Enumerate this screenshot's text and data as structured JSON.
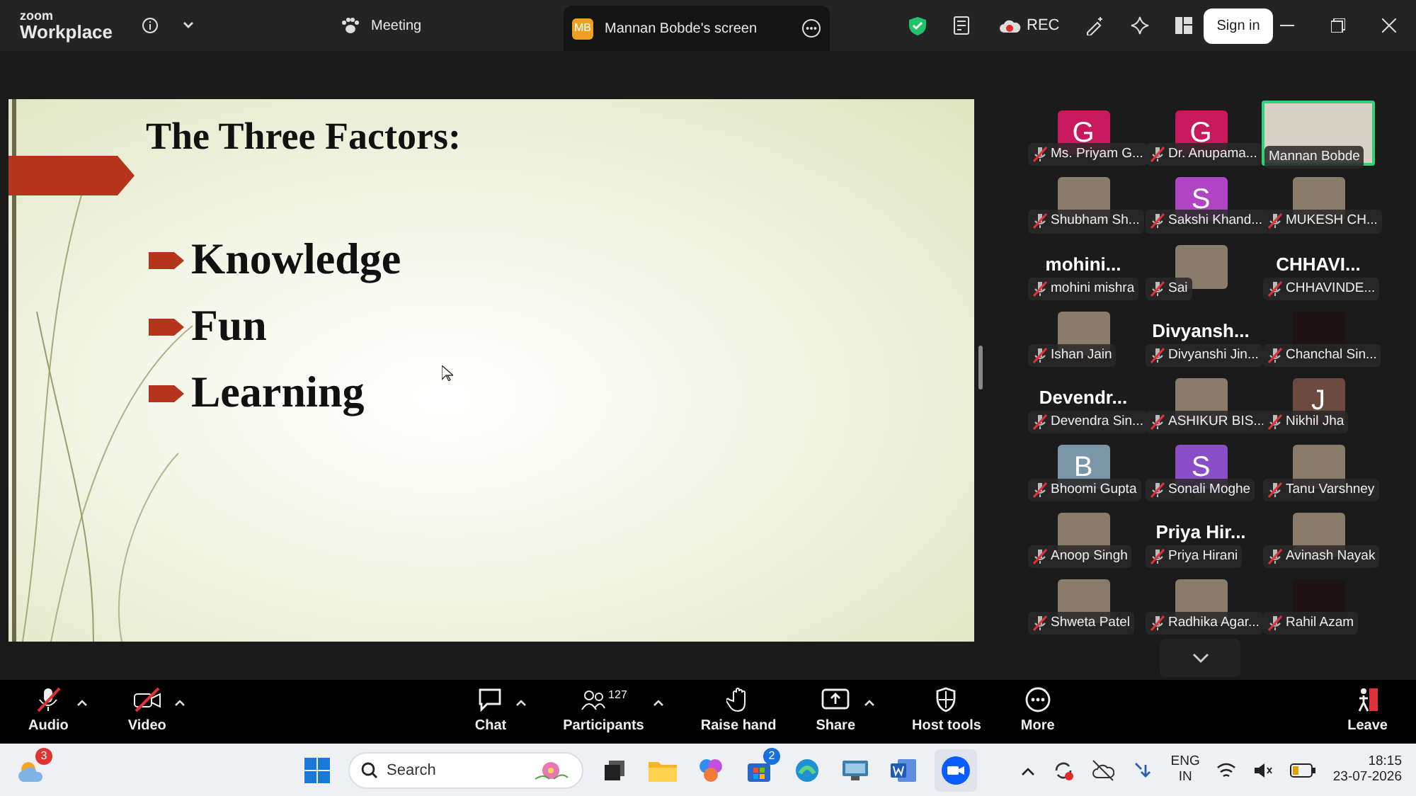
{
  "app_bar": {
    "logo_top": "zoom",
    "logo_bottom": "Workplace",
    "meeting_label": "Meeting",
    "share_tab": {
      "initials": "MB",
      "title": "Mannan Bobde's screen"
    },
    "rec_label": "REC",
    "sign_in": "Sign in"
  },
  "slide": {
    "title": "The Three Factors:",
    "bullets": [
      "Knowledge",
      "Fun",
      "Learning"
    ]
  },
  "participants": [
    {
      "kind": "letter",
      "letter": "G",
      "color": "#c8185e",
      "name": "Ms. Priyam G...",
      "muted": true,
      "speaking": false
    },
    {
      "kind": "letter",
      "letter": "G",
      "color": "#c8185e",
      "name": "Dr. Anupama...",
      "muted": true,
      "speaking": false
    },
    {
      "kind": "video",
      "name": "Mannan Bobde",
      "muted": false,
      "speaking": true
    },
    {
      "kind": "photo",
      "name": "Shubham Sh...",
      "muted": true,
      "speaking": false
    },
    {
      "kind": "letter",
      "letter": "S",
      "color": "#b044c4",
      "name": "Sakshi Khand...",
      "muted": true,
      "speaking": false
    },
    {
      "kind": "photo",
      "name": "MUKESH CH...",
      "muted": true,
      "speaking": false
    },
    {
      "kind": "text",
      "display": "mohini...",
      "name": "mohini mishra",
      "muted": true,
      "speaking": false
    },
    {
      "kind": "photo",
      "name": "Sai",
      "muted": true,
      "speaking": false
    },
    {
      "kind": "text",
      "display": "CHHAVI...",
      "name": "CHHAVINDE...",
      "muted": true,
      "speaking": false
    },
    {
      "kind": "photo",
      "name": "Ishan Jain",
      "muted": true,
      "speaking": false
    },
    {
      "kind": "text",
      "display": "Divyansh...",
      "name": "Divyanshi Jin...",
      "muted": true,
      "speaking": false
    },
    {
      "kind": "blank",
      "name": "Chanchal Sin...",
      "muted": true,
      "speaking": false
    },
    {
      "kind": "text",
      "display": "Devendr...",
      "name": "Devendra Sin...",
      "muted": true,
      "speaking": false
    },
    {
      "kind": "photo",
      "name": "ASHIKUR BIS...",
      "muted": true,
      "speaking": false
    },
    {
      "kind": "letter",
      "letter": "J",
      "color": "#6b4a40",
      "name": "Nikhil Jha",
      "muted": true,
      "speaking": false
    },
    {
      "kind": "letter",
      "letter": "B",
      "color": "#7b96a6",
      "name": "Bhoomi Gupta",
      "muted": true,
      "speaking": false
    },
    {
      "kind": "letter",
      "letter": "S",
      "color": "#8a4fc8",
      "name": "Sonali Moghe",
      "muted": true,
      "speaking": false
    },
    {
      "kind": "photo",
      "name": "Tanu Varshney",
      "muted": true,
      "speaking": false
    },
    {
      "kind": "photo",
      "name": "Anoop Singh",
      "muted": true,
      "speaking": false
    },
    {
      "kind": "text",
      "display": "Priya Hir...",
      "name": "Priya Hirani",
      "muted": true,
      "speaking": false
    },
    {
      "kind": "photo",
      "name": "Avinash Nayak",
      "muted": true,
      "speaking": false
    },
    {
      "kind": "photo",
      "name": "Shweta Patel",
      "muted": true,
      "speaking": false
    },
    {
      "kind": "photo",
      "name": "Radhika Agar...",
      "muted": true,
      "speaking": false
    },
    {
      "kind": "blank",
      "name": "Rahil Azam",
      "muted": true,
      "speaking": false
    }
  ],
  "toolbar": {
    "left": [
      {
        "kind": "audio",
        "label": "Audio",
        "off": true,
        "caret": true
      },
      {
        "kind": "video",
        "label": "Video",
        "off": true,
        "caret": true
      }
    ],
    "center": [
      {
        "kind": "chat",
        "label": "Chat",
        "caret": true
      },
      {
        "kind": "participants",
        "label": "Participants",
        "count": "127",
        "caret": true
      },
      {
        "kind": "raise-hand",
        "label": "Raise hand",
        "caret": false
      },
      {
        "kind": "share",
        "label": "Share",
        "caret": true
      },
      {
        "kind": "host-tools",
        "label": "Host tools",
        "caret": false
      },
      {
        "kind": "more",
        "label": "More",
        "caret": false
      }
    ],
    "right": [
      {
        "kind": "leave",
        "label": "Leave",
        "caret": false
      }
    ]
  },
  "taskbar": {
    "weather_badge": "3",
    "search_placeholder": "Search",
    "store_badge": "2",
    "language": "ENG",
    "region": "IN",
    "time": "18:15",
    "date": "23-07-2026"
  }
}
